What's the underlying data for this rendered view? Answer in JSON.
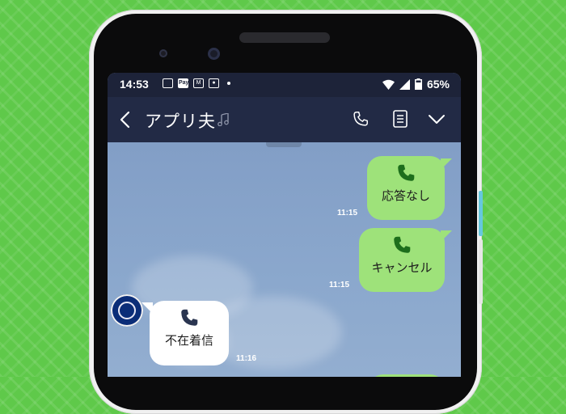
{
  "status_bar": {
    "time": "14:53",
    "pay_label": "Pay",
    "icons": [
      "image-icon",
      "pay-icon",
      "gmail-icon",
      "screenshot-icon",
      "dot-icon"
    ],
    "battery": "65%"
  },
  "header": {
    "title": "アプリ夫",
    "back_icon": "chevron-left-icon",
    "title_icon": "music-note-icon",
    "actions": [
      "phone-icon",
      "memo-icon",
      "chevron-down-icon"
    ]
  },
  "messages": [
    {
      "direction": "sent",
      "label": "応答なし",
      "time": "11:15",
      "icon": "phone-icon"
    },
    {
      "direction": "sent",
      "label": "キャンセル",
      "time": "11:15",
      "icon": "phone-icon"
    },
    {
      "direction": "received",
      "label": "不在着信",
      "time": "11:16",
      "icon": "phone-icon"
    }
  ],
  "colors": {
    "background": "#5fc94a",
    "header": "#222a45",
    "status_bar": "#1d2339",
    "chat_background": "#8aa4c9",
    "sent_bubble": "#9ee27a",
    "received_bubble": "#ffffff",
    "phone_icon_sent": "#1d6e1c",
    "phone_icon_received": "#2a3550"
  }
}
